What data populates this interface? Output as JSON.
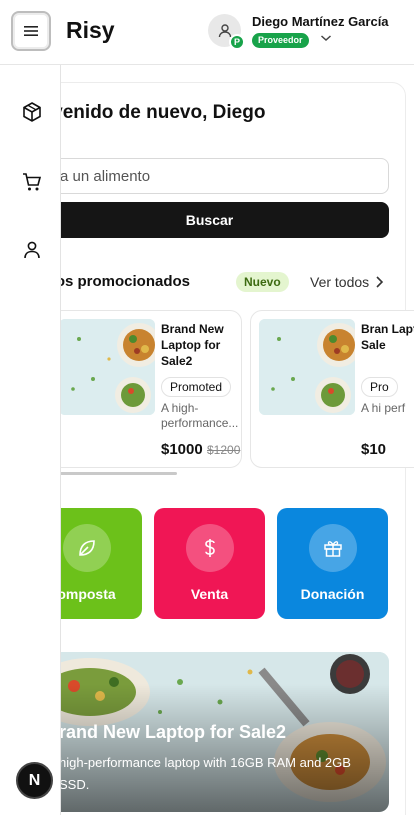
{
  "header": {
    "brand": "Risy",
    "user_name": "Diego Martínez García",
    "role_badge": "Proveedor",
    "avatar_initial": "P"
  },
  "sidebar": {
    "items": [
      {
        "icon": "package-icon"
      },
      {
        "icon": "cart-icon"
      },
      {
        "icon": "user-icon"
      }
    ]
  },
  "main": {
    "greeting": "envenido de nuevo, Diego",
    "search_placeholder": "sca un alimento",
    "search_button": "Buscar",
    "promo_section_title": "mentos promocionados",
    "new_badge": "Nuevo",
    "see_all": "Ver todos",
    "products": [
      {
        "title": "Brand New Laptop for Sale2",
        "badge": "Promoted",
        "description": "A high-performance...",
        "price": "$1000",
        "old_price": "$1200"
      },
      {
        "title": "Bran Lapt Sale",
        "badge": "Pro",
        "description": "A hi perf",
        "price": "$10",
        "old_price": ""
      }
    ],
    "categories": [
      {
        "label": "omposta",
        "icon": "leaf-icon",
        "color": "#6cc11a"
      },
      {
        "label": "Venta",
        "icon": "dollar-icon",
        "color": "#f01655"
      },
      {
        "label": "Donación",
        "icon": "gift-icon",
        "color": "#0a87de"
      }
    ],
    "banner": {
      "title": "rand New Laptop for Sale2",
      "description": "high-performance laptop with 16GB RAM and 2GB SSD."
    }
  },
  "fab": {
    "label": "N"
  }
}
